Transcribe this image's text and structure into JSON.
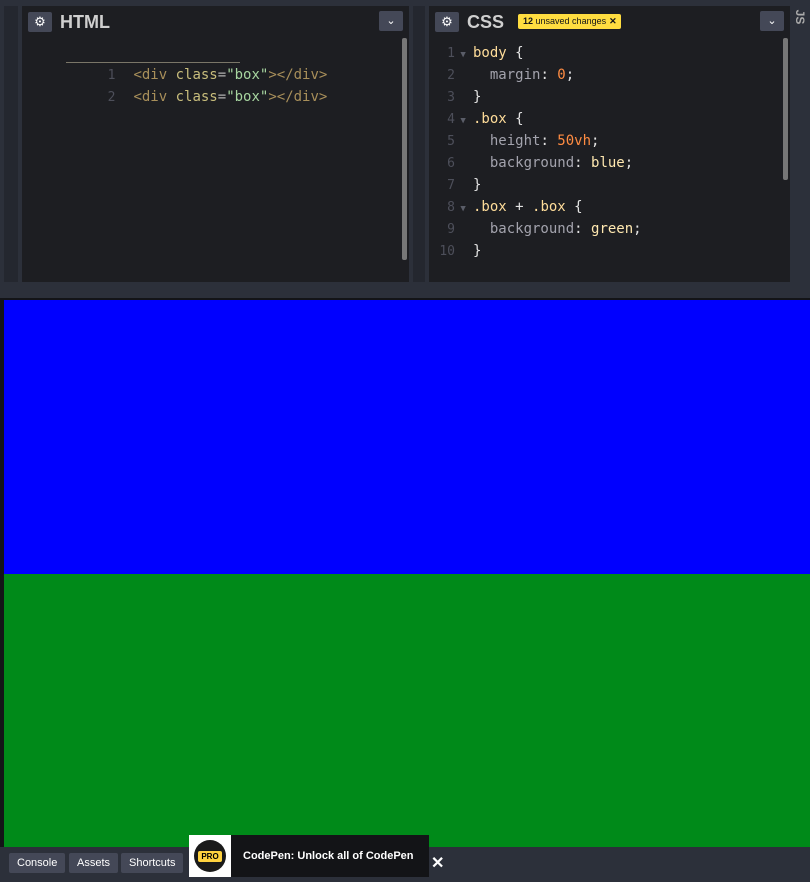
{
  "html_editor": {
    "title": "HTML",
    "lines": [
      {
        "num": "1",
        "tag_open": "<div",
        "attr": "class",
        "eq": "=",
        "str": "\"box\"",
        "tag_close": "></div>"
      },
      {
        "num": "2",
        "tag_open": "<div",
        "attr": "class",
        "eq": "=",
        "str": "\"box\"",
        "tag_close": "></div>"
      }
    ]
  },
  "css_editor": {
    "title": "CSS",
    "badge_count": "12",
    "badge_text": "unsaved changes",
    "badge_close": "✕",
    "lines": {
      "l1": {
        "num": "1",
        "selector": "body",
        "punc": " {"
      },
      "l2": {
        "num": "2",
        "prop": "margin",
        "colon": ": ",
        "value": "0",
        "semi": ";"
      },
      "l3": {
        "num": "3",
        "punc": "}"
      },
      "l4": {
        "num": "4",
        "selector": ".box",
        "punc": " {"
      },
      "l5": {
        "num": "5",
        "prop": "height",
        "colon": ": ",
        "value": "50vh",
        "semi": ";"
      },
      "l6": {
        "num": "6",
        "prop": "background",
        "colon": ": ",
        "value": "blue",
        "semi": ";"
      },
      "l7": {
        "num": "7",
        "punc": "}"
      },
      "l8": {
        "num": "8",
        "selector1": ".box",
        "plus": " + ",
        "selector2": ".box",
        "punc": " {"
      },
      "l9": {
        "num": "9",
        "prop": "background",
        "colon": ": ",
        "value": "green",
        "semi": ";"
      },
      "l10": {
        "num": "10",
        "punc": "}"
      }
    }
  },
  "js_editor": {
    "title": "JS"
  },
  "icons": {
    "gear": "gear-icon",
    "chevron": "chevron-down-icon",
    "close": "close-icon"
  },
  "preview_colors": {
    "box1": "#0000ff",
    "box2": "#008a19"
  },
  "bottom_bar": {
    "console": "Console",
    "assets": "Assets",
    "shortcuts": "Shortcuts"
  },
  "promo": {
    "logo_text": "PRO",
    "text": "CodePen: Unlock all of CodePen",
    "close": "✕"
  }
}
